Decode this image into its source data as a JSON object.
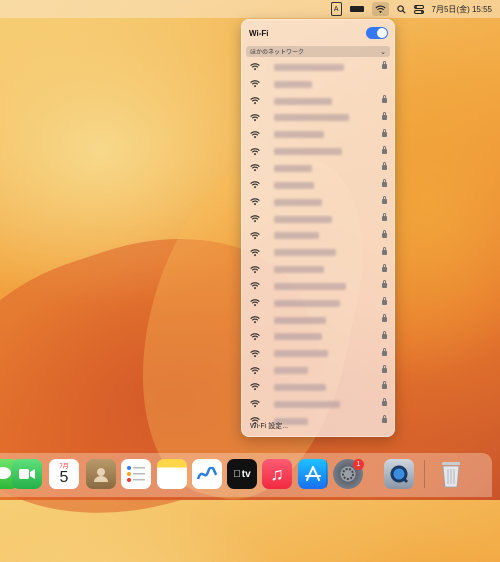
{
  "menubar": {
    "input_indicator": "A",
    "datetime": "7月5日(金)  15:55"
  },
  "wifi": {
    "title": "Wi-Fi",
    "enabled": true,
    "section_label": "ほかのネットワーク",
    "settings_label": "Wi-Fi 設定...",
    "networks": [
      {
        "name": "",
        "locked": true
      },
      {
        "name": "",
        "locked": false
      },
      {
        "name": "",
        "locked": true
      },
      {
        "name": "",
        "locked": true
      },
      {
        "name": "",
        "locked": true
      },
      {
        "name": "",
        "locked": true
      },
      {
        "name": "",
        "locked": true
      },
      {
        "name": "",
        "locked": true
      },
      {
        "name": "",
        "locked": true
      },
      {
        "name": "",
        "locked": true
      },
      {
        "name": "",
        "locked": true
      },
      {
        "name": "",
        "locked": true
      },
      {
        "name": "",
        "locked": true
      },
      {
        "name": "",
        "locked": true
      },
      {
        "name": "",
        "locked": true
      },
      {
        "name": "",
        "locked": true
      },
      {
        "name": "",
        "locked": true
      },
      {
        "name": "",
        "locked": true
      },
      {
        "name": "",
        "locked": true
      },
      {
        "name": "",
        "locked": true
      },
      {
        "name": "",
        "locked": true
      },
      {
        "name": "",
        "locked": true
      }
    ]
  },
  "dock": {
    "calendar_month": "7月",
    "calendar_day": "5",
    "tv_label": "tv",
    "badge_count": "1",
    "icons": [
      "messages-icon",
      "facetime-icon",
      "calendar-icon",
      "contacts-icon",
      "reminders-icon",
      "notes-icon",
      "freeform-icon",
      "tv-icon",
      "music-icon",
      "app-store-icon",
      "system-settings-icon",
      "quicktime-icon",
      "trash-icon"
    ]
  },
  "colors": {
    "accent": "#3478f6",
    "badge": "#e33333"
  }
}
